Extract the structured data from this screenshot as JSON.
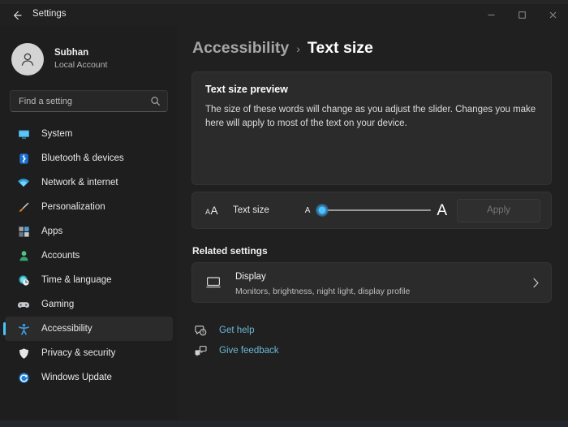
{
  "window": {
    "title": "Settings",
    "back_tooltip": "Back",
    "controls": {
      "minimize": "Minimize",
      "maximize": "Maximize",
      "close": "Close"
    }
  },
  "account": {
    "name": "Subhan",
    "type": "Local Account"
  },
  "search": {
    "placeholder": "Find a setting",
    "value": ""
  },
  "sidebar": {
    "items": [
      {
        "label": "System",
        "icon": "monitor-icon",
        "selected": false
      },
      {
        "label": "Bluetooth & devices",
        "icon": "bluetooth-icon",
        "selected": false
      },
      {
        "label": "Network & internet",
        "icon": "wifi-icon",
        "selected": false
      },
      {
        "label": "Personalization",
        "icon": "paintbrush-icon",
        "selected": false
      },
      {
        "label": "Apps",
        "icon": "apps-grid-icon",
        "selected": false
      },
      {
        "label": "Accounts",
        "icon": "person-icon",
        "selected": false
      },
      {
        "label": "Time & language",
        "icon": "clock-globe-icon",
        "selected": false
      },
      {
        "label": "Gaming",
        "icon": "gamepad-icon",
        "selected": false
      },
      {
        "label": "Accessibility",
        "icon": "accessibility-icon",
        "selected": true
      },
      {
        "label": "Privacy & security",
        "icon": "shield-icon",
        "selected": false
      },
      {
        "label": "Windows Update",
        "icon": "update-icon",
        "selected": false
      }
    ]
  },
  "breadcrumb": {
    "parent": "Accessibility",
    "separator": "›",
    "current": "Text size"
  },
  "preview": {
    "title": "Text size preview",
    "body": "The size of these words will change as you adjust the slider. Changes you make here will apply to most of the text on your device."
  },
  "text_size": {
    "icon_small_a": "A",
    "icon_big_a": "A",
    "label": "Text size",
    "slider_min_label": "A",
    "slider_max_label": "A",
    "slider_value": 0,
    "slider_min": 0,
    "slider_max": 100,
    "apply_label": "Apply",
    "apply_enabled": false
  },
  "related": {
    "section_title": "Related settings",
    "display": {
      "title": "Display",
      "subtitle": "Monitors, brightness, night light, display profile",
      "chevron": "›"
    }
  },
  "links": [
    {
      "label": "Get help",
      "icon": "help-icon"
    },
    {
      "label": "Give feedback",
      "icon": "feedback-icon"
    }
  ],
  "colors": {
    "accent": "#4cc2ff",
    "link": "#6cb8d6",
    "window_bg": "#202020",
    "sidebar_bg": "#1e1e1e",
    "card_bg": "#2b2b2b"
  }
}
